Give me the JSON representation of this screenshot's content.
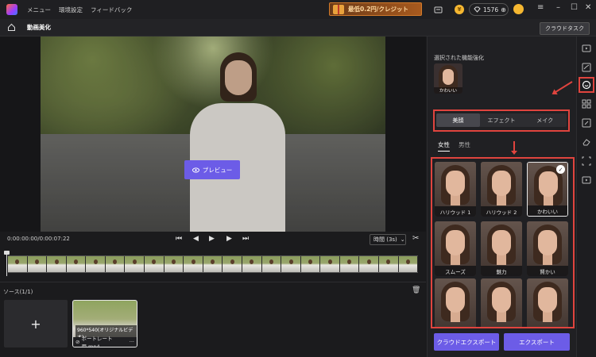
{
  "titlebar": {
    "menu": [
      "メニュー",
      "環境設定",
      "フィードバック"
    ],
    "promo": "最低0.2円/クレジット",
    "credits": "1576"
  },
  "tabbar": {
    "title": "動画美化",
    "cloud_task": "クラウドタスク"
  },
  "preview": {
    "button": "プレビュー"
  },
  "controls": {
    "time": "0:00:00:00/0:00:07:22",
    "interval": "時間 (3s)"
  },
  "source": {
    "label": "ソース(1/1)",
    "add": "+",
    "clip_resolution": "960*540(オリジナルビデオ)",
    "clip_name": "ポートレート用.mp4"
  },
  "panel": {
    "selected_label": "選択された機能強化",
    "selected_caption": "かわいい",
    "tabs": [
      "美顔",
      "エフェクト",
      "メイク"
    ],
    "active_tab": 0,
    "genders": [
      "女性",
      "男性"
    ],
    "styles": [
      {
        "label": "ハリウッド 1",
        "selected": false
      },
      {
        "label": "ハリウッド 2",
        "selected": false
      },
      {
        "label": "かわいい",
        "selected": true
      },
      {
        "label": "スムーズ",
        "selected": false
      },
      {
        "label": "魅力",
        "selected": false
      },
      {
        "label": "賢かい",
        "selected": false
      },
      {
        "label": "",
        "selected": false
      },
      {
        "label": "",
        "selected": false
      },
      {
        "label": "",
        "selected": false
      }
    ],
    "cloud_export": "クラウドエクスポート",
    "export": "エクスポート"
  },
  "colors": {
    "accent": "#6c5ce7",
    "highlight": "#e0443e"
  }
}
